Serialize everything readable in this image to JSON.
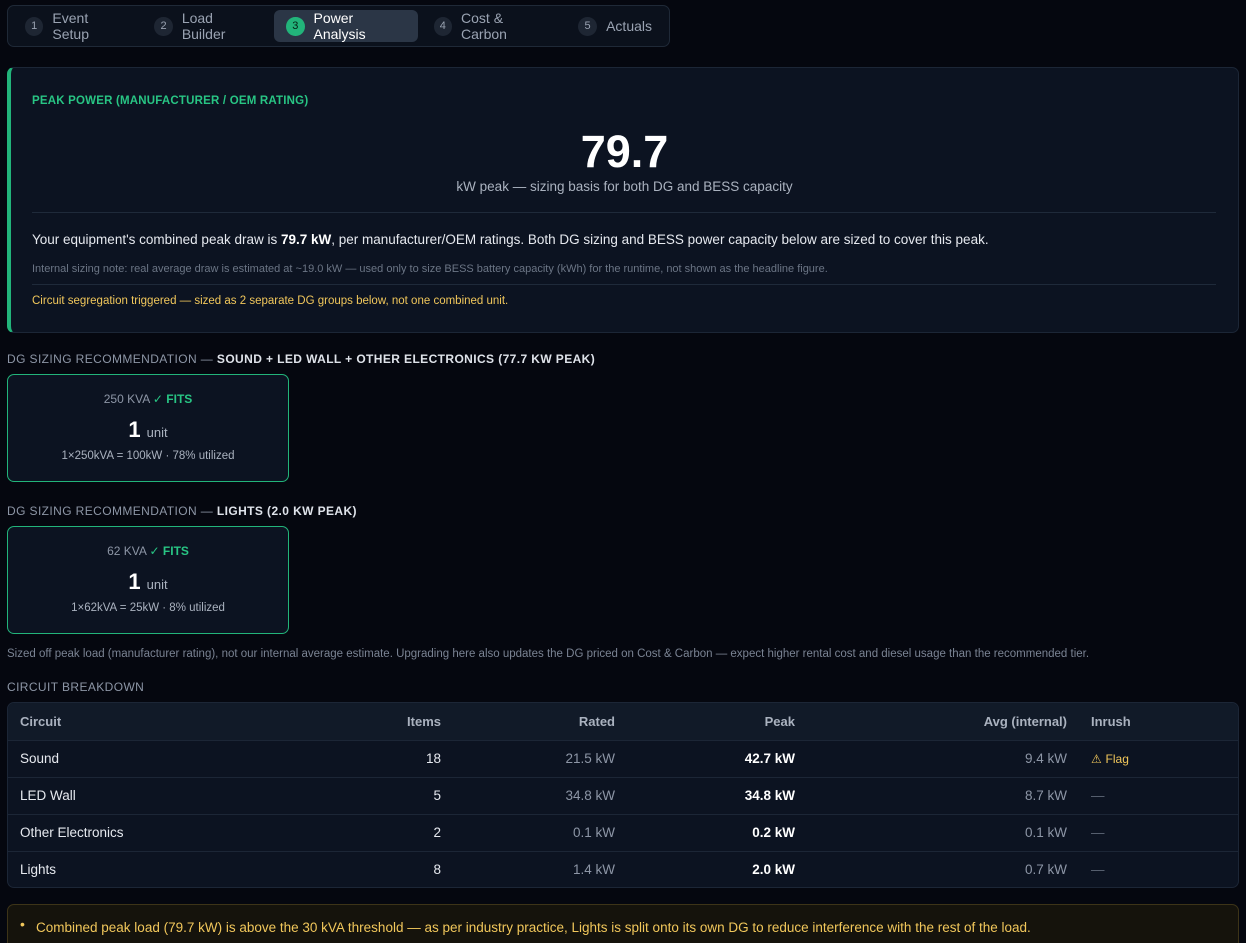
{
  "tabs": [
    {
      "num": "1",
      "label": "Event Setup"
    },
    {
      "num": "2",
      "label": "Load Builder"
    },
    {
      "num": "3",
      "label": "Power Analysis",
      "active": true
    },
    {
      "num": "4",
      "label": "Cost & Carbon"
    },
    {
      "num": "5",
      "label": "Actuals"
    }
  ],
  "peak": {
    "label": "PEAK POWER (MANUFACTURER / OEM RATING)",
    "value": "79.7",
    "subtitle": "kW peak — sizing basis for both DG and BESS capacity",
    "desc_prefix": "Your equipment's combined peak draw is ",
    "desc_bold": "79.7 kW",
    "desc_suffix": ", per manufacturer/OEM ratings. Both DG sizing and BESS power capacity below are sized to cover this peak.",
    "note": "Internal sizing note: real average draw is estimated at ~19.0 kW — used only to size BESS battery capacity (kWh) for the runtime, not shown as the headline figure.",
    "warning": "Circuit segregation triggered — sized as 2 separate DG groups below, not one combined unit."
  },
  "dg_groups": [
    {
      "heading_prefix": "DG SIZING RECOMMENDATION —",
      "heading_strong": "SOUND + LED WALL + OTHER ELECTRONICS (77.7 KW PEAK)",
      "kva": "250 KVA",
      "fits": "✓ FITS",
      "units": "1",
      "unit_label": "unit",
      "detail": "1×250kVA = 100kW · 78% utilized"
    },
    {
      "heading_prefix": "DG SIZING RECOMMENDATION —",
      "heading_strong": "LIGHTS (2.0 KW PEAK)",
      "kva": "62 KVA",
      "fits": "✓ FITS",
      "units": "1",
      "unit_label": "unit",
      "detail": "1×62kVA = 25kW · 8% utilized"
    }
  ],
  "sized_note": "Sized off peak load (manufacturer rating), not our internal average estimate. Upgrading here also updates the DG priced on Cost & Carbon — expect higher rental cost and diesel usage than the recommended tier.",
  "breakdown": {
    "heading": "CIRCUIT BREAKDOWN",
    "columns": [
      "Circuit",
      "Items",
      "Rated",
      "Peak",
      "Avg (internal)",
      "Inrush"
    ],
    "rows": [
      {
        "circuit": "Sound",
        "items": "18",
        "rated": "21.5 kW",
        "peak": "42.7 kW",
        "avg": "9.4 kW",
        "inrush": "Flag"
      },
      {
        "circuit": "LED Wall",
        "items": "5",
        "rated": "34.8 kW",
        "peak": "34.8 kW",
        "avg": "8.7 kW",
        "inrush": "—"
      },
      {
        "circuit": "Other Electronics",
        "items": "2",
        "rated": "0.1 kW",
        "peak": "0.2 kW",
        "avg": "0.1 kW",
        "inrush": "—"
      },
      {
        "circuit": "Lights",
        "items": "8",
        "rated": "1.4 kW",
        "peak": "2.0 kW",
        "avg": "0.7 kW",
        "inrush": "—"
      }
    ]
  },
  "bottom_warning": "Combined peak load (79.7 kW) is above the 30 kVA threshold — as per industry practice, Lights is split onto its own DG to reduce interference with the rest of the load.",
  "colors": {
    "accent": "#22b47a",
    "warning": "#f1c75b",
    "background": "#05070f",
    "card": "#0c1321"
  }
}
